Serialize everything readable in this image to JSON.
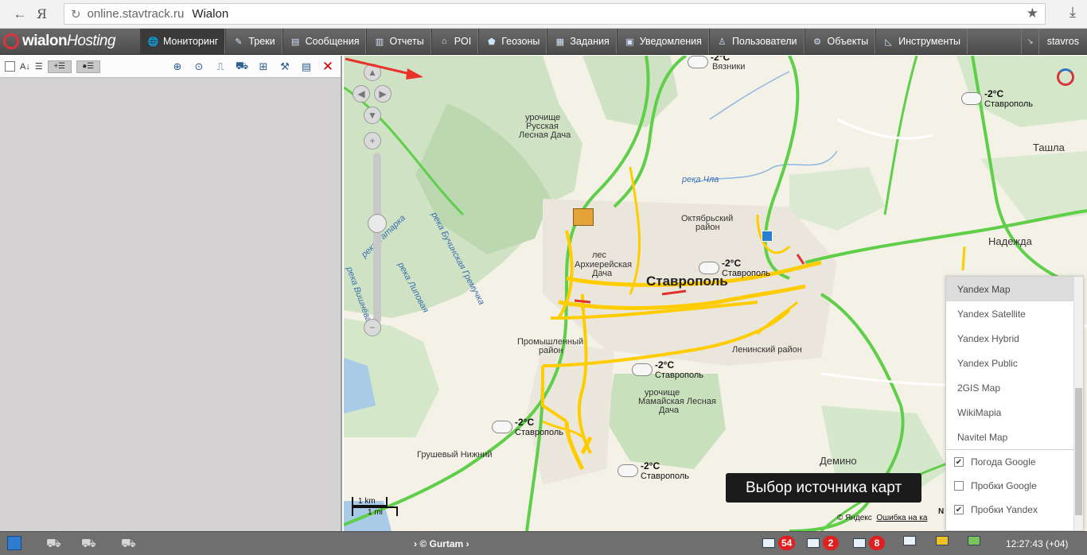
{
  "browser": {
    "back_icon": "arrow-left-icon",
    "yandex_glyph": "Я",
    "url_host": "online.stavtrack.ru",
    "page_title": "Wialon"
  },
  "menu": {
    "logo_main": "wialon",
    "logo_sub": "Hosting",
    "items": [
      {
        "label": "Мониторинг",
        "icon": "globe-icon"
      },
      {
        "label": "Треки",
        "icon": "track-icon"
      },
      {
        "label": "Сообщения",
        "icon": "messages-icon"
      },
      {
        "label": "Отчеты",
        "icon": "reports-icon"
      },
      {
        "label": "POI",
        "icon": "poi-icon"
      },
      {
        "label": "Геозоны",
        "icon": "geofence-icon"
      },
      {
        "label": "Задания",
        "icon": "jobs-icon"
      },
      {
        "label": "Уведомления",
        "icon": "notifications-icon"
      },
      {
        "label": "Пользователи",
        "icon": "users-icon"
      },
      {
        "label": "Объекты",
        "icon": "units-icon"
      },
      {
        "label": "Инструменты",
        "icon": "tools-icon"
      }
    ],
    "user": "stavros"
  },
  "map": {
    "places": {
      "vyazniki": "Вязники",
      "tashla": "Ташла",
      "nadezhda": "Надежда",
      "russkaya1": "урочище",
      "russkaya2": "Русская",
      "russkaya3": "Лесная Дача",
      "river_chla": "река Чла",
      "oktyabr1": "Октябрьский",
      "oktyabr2": "район",
      "les1": "лес",
      "les2": "Архиерейская",
      "les3": "Дача",
      "city": "Ставрополь",
      "prom1": "Промышленный",
      "prom2": "район",
      "lenin": "Ленинский район",
      "mam1": "урочище",
      "mam2": "Мамайская Лесная",
      "mam3": "Дача",
      "grush": "Грушевый Нижний",
      "demino": "Демино",
      "buch": "река Бучинская Гремучка",
      "tatarka": "река Татарка",
      "lipova": "река Липовая",
      "vishneva": "река Вишнёва"
    },
    "weather": {
      "temp": "-2°C",
      "city": "Ставрополь",
      "top_temp": "-2°C"
    },
    "scale": {
      "km": "1 km",
      "mi": "1 mi"
    },
    "copyright": "© Яндекс",
    "error_link": "Ошибка на ка",
    "compass": "N",
    "tooltip": "Выбор источника карт"
  },
  "layers": {
    "sources": [
      "Yandex Map",
      "Yandex Satellite",
      "Yandex Hybrid",
      "Yandex Public",
      "2GIS Map",
      "WikiMapia",
      "Navitel Map"
    ],
    "selected": "Yandex Map",
    "overlays": [
      {
        "label": "Погода Google",
        "checked": true
      },
      {
        "label": "Пробки Google",
        "checked": false
      },
      {
        "label": "Пробки Yandex",
        "checked": true
      }
    ]
  },
  "statusbar": {
    "gurtam": "© Gurtam",
    "messages_count": "54",
    "events_count": "2",
    "images_count": "8",
    "time": "12:27:43 (+04)"
  },
  "colors": {
    "menu_bg": "#5a5a5a",
    "road_green": "#5fcf4a",
    "road_yellow": "#ffcc00",
    "badge_red": "#e02020"
  }
}
